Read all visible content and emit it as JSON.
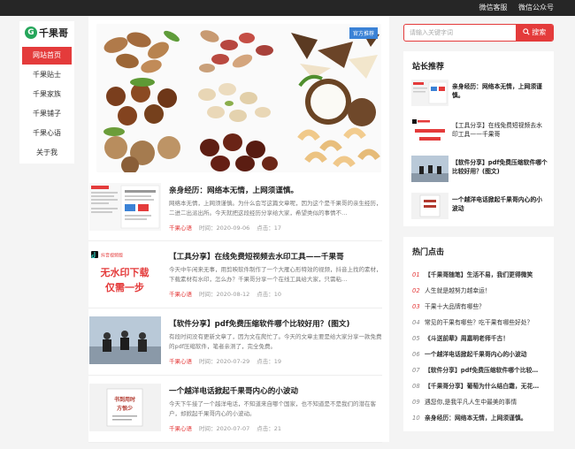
{
  "topbar": {
    "links": [
      "微信客服",
      "微信公众号"
    ]
  },
  "logo": {
    "mark": "G",
    "text": "千果哥"
  },
  "nav": [
    "网站首页",
    "千果贴士",
    "千果家族",
    "千果铺子",
    "千果心语",
    "关于我"
  ],
  "banner": {
    "tag": "官方推荐"
  },
  "search": {
    "placeholder": "请输入关键字词",
    "button": "搜索"
  },
  "articles": [
    {
      "title": "亲身经历：网络本无情，上网须谨慎。",
      "desc": "网络本无情，上网须谨慎。为什么会写这篇文章呢，因为这个是千果哥的亲生经历，二进二出派出所。今天就把这段经历分享给大家，希望类似的事情不…",
      "category": "千果心语",
      "time_label": "时间：",
      "time": "2020-09-06",
      "clicks_label": "点击：",
      "clicks": "17"
    },
    {
      "title": "【工具分享】在线免费短视频去水印工具——千果哥",
      "desc": "今天中午闲来无事，用剪映软件制作了一个大雁心形特效的视频，抖音上找的素材，下载素材有水印，怎么办？千果哥分享一个在线工具给大家，只需粘…",
      "category": "千果心语",
      "time_label": "时间：",
      "time": "2020-08-12",
      "clicks_label": "点击：",
      "clicks": "10"
    },
    {
      "title": "【软件分享】pdf免费压缩软件哪个比较好用？(图文)",
      "desc": "有段时间没有更新文章了，因为文在爬忙了。今天的文章主要是给大家分享一款免费的pdf压缩软件，笔者亲测了，完全免费。",
      "category": "千果心语",
      "time_label": "时间：",
      "time": "2020-07-29",
      "clicks_label": "点击：",
      "clicks": "19"
    },
    {
      "title": "一个越洋电话掀起千果哥内心的小波动",
      "desc": "今天下午接了一个越洋电话，不知道来自哪个国家，也不知道是不是我们的潜在客户，却掀起千果哥内心的小波动。",
      "category": "千果心语",
      "time_label": "时间：",
      "time": "2020-07-07",
      "clicks_label": "点击：",
      "clicks": "21"
    }
  ],
  "sidebar_recommend": {
    "title": "站长推荐",
    "items": [
      "亲身经历：网络本无情，上网须谨慎。",
      "【工具分享】在线免费短视频去水印工具——千果哥",
      "【软件分享】pdf免费压缩软件哪个比较好用？(图文)",
      "一个越洋电话掀起千果哥内心的小波动"
    ]
  },
  "thumb_text": {
    "tiktok": "抖音视频版",
    "watermark_line1": "无水印下载",
    "watermark_line2": "仅需一步",
    "note_line1": "书到用时",
    "note_line2": "方恨少"
  },
  "sidebar_hot": {
    "title": "热门点击",
    "items": [
      {
        "num": "01",
        "text": "【千果哥随笔】生活不易，我们更得微笑",
        "bold": true
      },
      {
        "num": "02",
        "text": "人生就是越努力越幸运！",
        "bold": false
      },
      {
        "num": "03",
        "text": "干果十大品牌有哪些？",
        "bold": false
      },
      {
        "num": "04",
        "text": "常见的干果有哪些？吃干果有哪些好处？",
        "bold": false
      },
      {
        "num": "05",
        "text": "《斗送前辈》周嘉明老师千古！",
        "bold": true
      },
      {
        "num": "06",
        "text": "一个越洋电话掀起千果哥内心的小波动",
        "bold": true
      },
      {
        "num": "07",
        "text": "【软件分享】pdf免费压缩软件哪个比较…",
        "bold": true
      },
      {
        "num": "08",
        "text": "【千果哥分享】葡萄为什么结白霜，无花…",
        "bold": true
      },
      {
        "num": "09",
        "text": "遇您你,是我平凡人生中最美的事情",
        "bold": false
      },
      {
        "num": "10",
        "text": "亲身经历：网络本无情，上网须谨慎。",
        "bold": true
      }
    ]
  },
  "colors": {
    "accent": "#e43b3b",
    "topbar": "#262626",
    "logo": "#26a65b"
  }
}
